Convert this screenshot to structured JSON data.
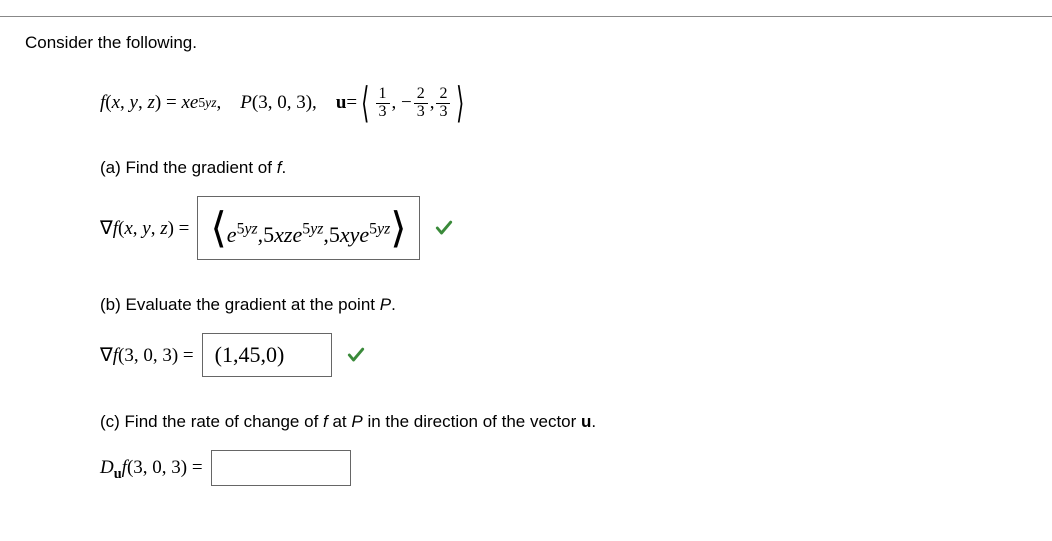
{
  "intro": "Consider the following.",
  "problem": {
    "fn_label": "f",
    "fn_args": "(x, y, z) = xe",
    "fn_exp": "5yz",
    "point_label": "P",
    "point_value": "(3, 0, 3),",
    "u_label": "u",
    "u_eq": " = ",
    "u_frac1_num": "1",
    "u_frac1_den": "3",
    "u_sep1": ", ",
    "u_minus": "− ",
    "u_frac2_num": "2",
    "u_frac2_den": "3",
    "u_sep2": ", ",
    "u_frac3_num": "2",
    "u_frac3_den": "3"
  },
  "parts": {
    "a": {
      "label": "(a) Find the gradient of f.",
      "lhs_prefix": "∇",
      "lhs_fn": "f",
      "lhs_args": "(x, y, z) = ",
      "answer_e1": "e",
      "answer_exp": "5yz",
      "answer_c1": ",5xze",
      "answer_c2": ",5xye",
      "correct": true
    },
    "b": {
      "label": "(b) Evaluate the gradient at the point P.",
      "lhs_prefix": "∇",
      "lhs_fn": "f",
      "lhs_args": "(3, 0, 3) = ",
      "answer": "(1,45,0)",
      "correct": true
    },
    "c": {
      "label": "(c) Find the rate of change of f at P in the direction of the vector u.",
      "lhs_d": "D",
      "lhs_sub": "u",
      "lhs_fn": "f",
      "lhs_args": "(3, 0, 3) = ",
      "answer": ""
    }
  }
}
